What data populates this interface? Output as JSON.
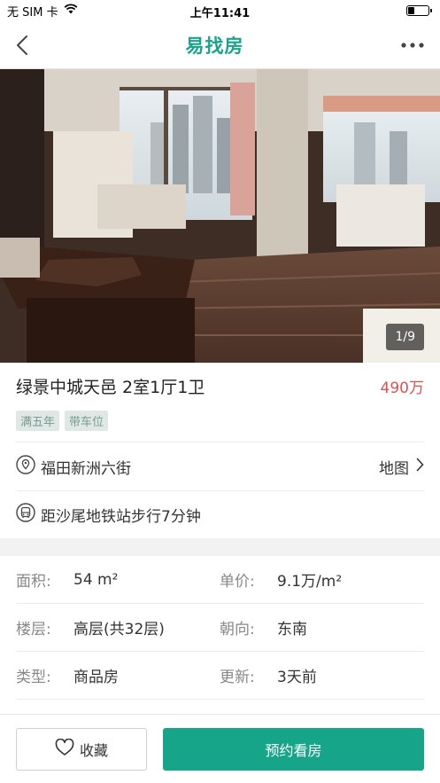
{
  "status_bar": {
    "carrier": "无 SIM 卡",
    "time": "上午11:41"
  },
  "nav": {
    "title": "易找房",
    "back_icon": "chevron-left-icon",
    "more_icon": "more-dots-icon"
  },
  "gallery": {
    "counter": "1/9"
  },
  "listing": {
    "title": "绿景中城天邑  2室1厅1卫",
    "price": "490万",
    "tags": [
      "满五年",
      "带车位"
    ]
  },
  "location": {
    "address": "福田新洲六街",
    "map_label": "地图"
  },
  "transit": {
    "text": "距沙尾地铁站步行7分钟"
  },
  "specs": [
    {
      "l1": "面积:",
      "v1": "54 m²",
      "l2": "单价:",
      "v2": "9.1万/m²"
    },
    {
      "l1": "楼层:",
      "v1": "高层(共32层)",
      "l2": "朝向:",
      "v2": "东南"
    },
    {
      "l1": "类型:",
      "v1": "商品房",
      "l2": "更新:",
      "v2": "3天前"
    }
  ],
  "actions": {
    "favorite": "收藏",
    "book": "预约看房"
  },
  "colors": {
    "accent": "#17a589",
    "price": "#e94e4e"
  }
}
